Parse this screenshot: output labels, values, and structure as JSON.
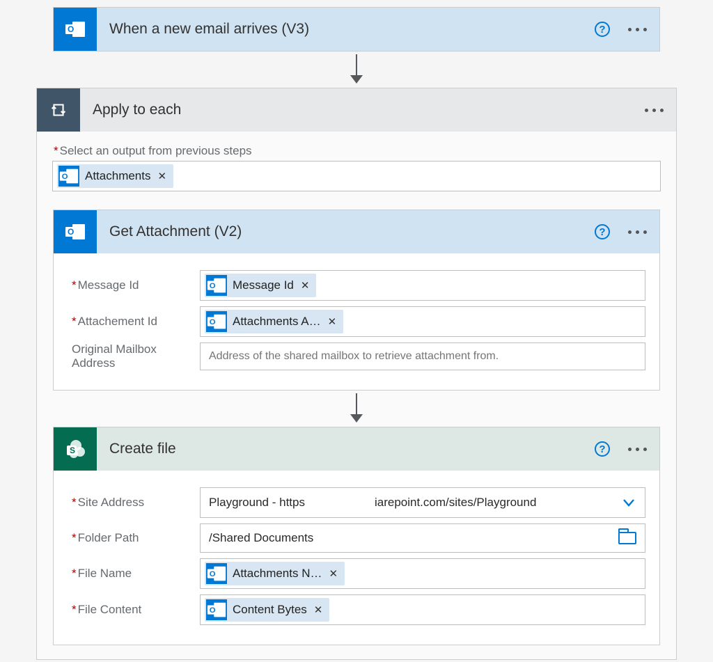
{
  "trigger": {
    "title": "When a new email arrives (V3)"
  },
  "applyToEach": {
    "title": "Apply to each",
    "outputLabel": "Select an output from previous steps",
    "outputToken": "Attachments"
  },
  "getAttachment": {
    "title": "Get Attachment (V2)",
    "fields": {
      "messageId": {
        "label": "Message Id",
        "token": "Message Id"
      },
      "attachmentId": {
        "label": "Attachement Id",
        "token": "Attachments A…"
      },
      "mailbox": {
        "label": "Original Mailbox Address",
        "placeholder": "Address of the shared mailbox to retrieve attachment from."
      }
    }
  },
  "createFile": {
    "title": "Create file",
    "fields": {
      "siteAddress": {
        "label": "Site Address",
        "left": "Playground - https",
        "right": "iarepoint.com/sites/Playground"
      },
      "folderPath": {
        "label": "Folder Path",
        "value": "/Shared Documents"
      },
      "fileName": {
        "label": "File Name",
        "token": "Attachments N…"
      },
      "fileContent": {
        "label": "File Content",
        "token": "Content Bytes"
      }
    }
  }
}
